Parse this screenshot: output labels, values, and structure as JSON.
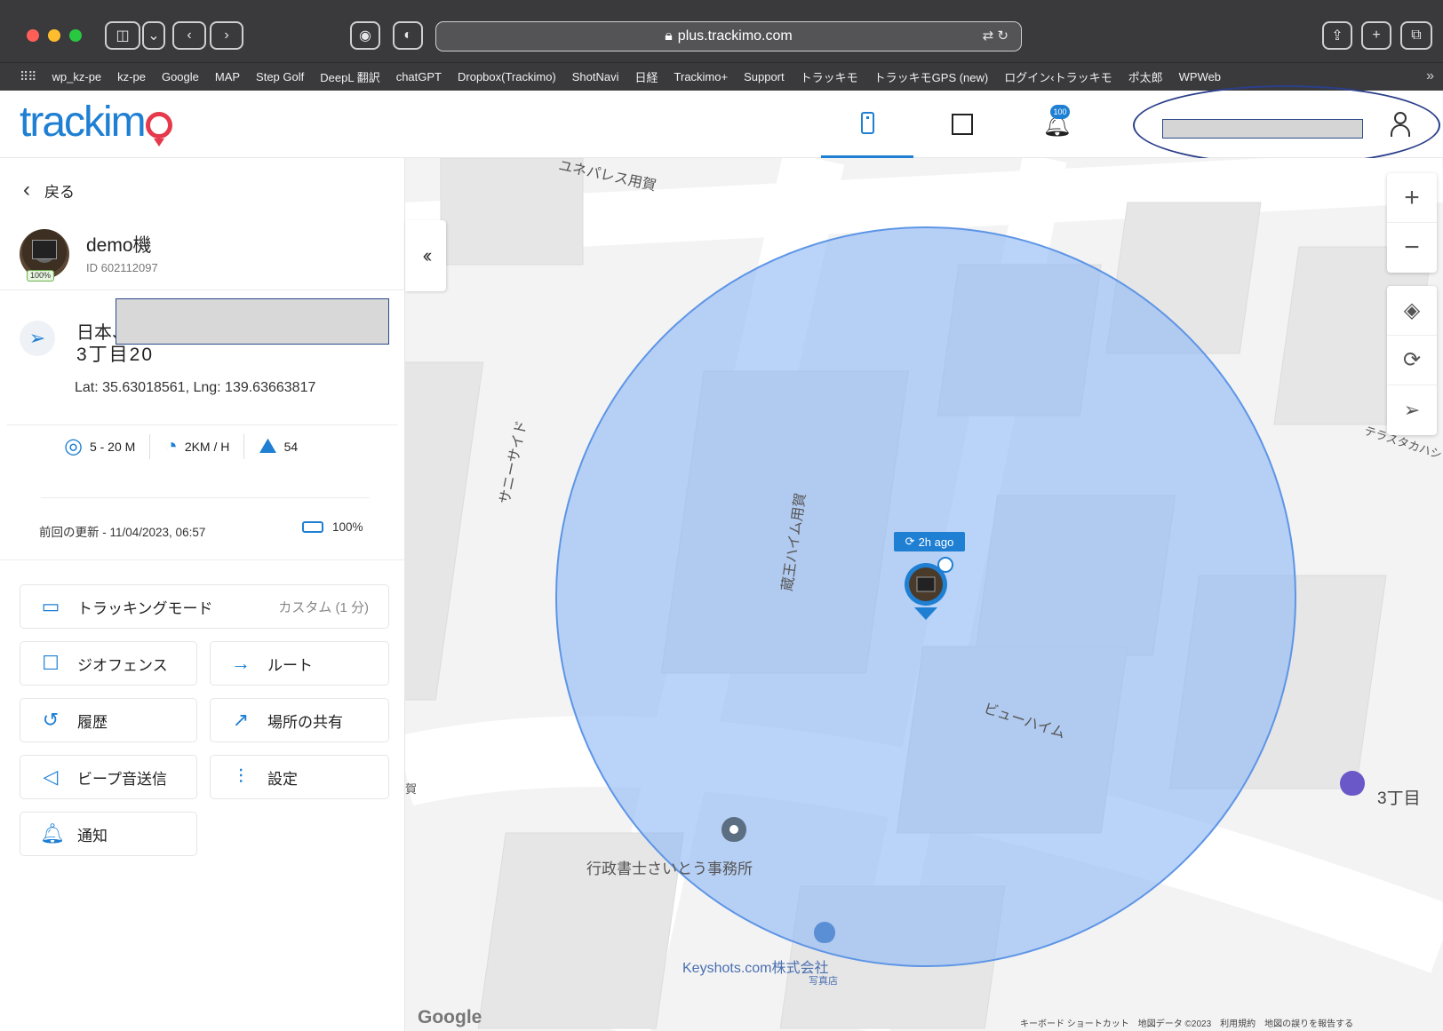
{
  "browser": {
    "url": "plus.trackimo.com",
    "bookmarks": [
      "wp_kz-pe",
      "kz-pe",
      "Google",
      "MAP",
      "Step Golf",
      "DeepL 翻訳",
      "chatGPT",
      "Dropbox(Trackimo)",
      "ShotNavi",
      "日経",
      "Trackimo+",
      "Support",
      "トラッキモ",
      "トラッキモGPS (new)",
      "ログイン‹トラッキモ",
      "ポ太郎",
      "WPWeb"
    ]
  },
  "header": {
    "logo": "trackimo",
    "bell_badge": "100"
  },
  "sidebar": {
    "back_label": "戻る",
    "device_name": "demo機",
    "device_id": "ID 602112097",
    "battery_tag": "100%",
    "address_line1": "日本、",
    "address_line2": "3丁目20",
    "latlng": "Lat: 35.63018561, Lng: 139.63663817",
    "stats": {
      "accuracy": "5 - 20 M",
      "speed": "2KM / H",
      "altitude": "54"
    },
    "last_update": "前回の更新 - 11/04/2023, 06:57",
    "battery": "100%",
    "menu": {
      "tracking_mode": "トラッキングモード",
      "tracking_mode_value": "カスタム (1 分)",
      "geofence": "ジオフェンス",
      "route": "ルート",
      "history": "履歴",
      "share_location": "場所の共有",
      "beep": "ビープ音送信",
      "settings": "設定",
      "notifications": "通知"
    }
  },
  "map": {
    "ago_badge": "2h ago",
    "labels": {
      "top": "ユネパレス用賀",
      "sunny_side": "サニーサイド",
      "building": "蔵王ハイム用賀",
      "view_heim": "ビューハイム",
      "terrace": "テラスタカハシ",
      "chome": "3丁目",
      "office": "行政書士さいとう事務所",
      "keyshots": "Keyshots.com株式会社",
      "photo_studio": "写真店",
      "left_partial": "賀"
    },
    "google": "Google",
    "footer": "キーボード ショートカット　地図データ ©2023　利用規約　地図の誤りを報告する"
  },
  "colors": {
    "accent": "#1e7fd3",
    "logo_pin": "#e53a4b",
    "geofence_fill": "#8fb8f3"
  }
}
